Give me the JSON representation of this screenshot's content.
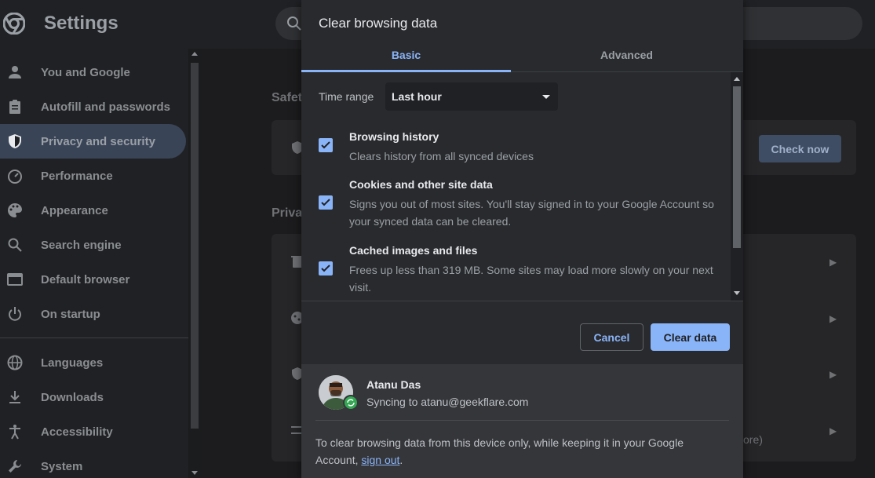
{
  "header": {
    "title": "Settings"
  },
  "sidebar": {
    "items": [
      {
        "label": "You and Google",
        "icon": "person-icon"
      },
      {
        "label": "Autofill and passwords",
        "icon": "clipboard-icon"
      },
      {
        "label": "Privacy and security",
        "icon": "shield-icon",
        "active": true
      },
      {
        "label": "Performance",
        "icon": "speedometer-icon"
      },
      {
        "label": "Appearance",
        "icon": "palette-icon"
      },
      {
        "label": "Search engine",
        "icon": "search-icon"
      },
      {
        "label": "Default browser",
        "icon": "browser-icon"
      },
      {
        "label": "On startup",
        "icon": "power-icon"
      },
      {
        "label": "Languages",
        "icon": "globe-icon"
      },
      {
        "label": "Downloads",
        "icon": "download-icon"
      },
      {
        "label": "Accessibility",
        "icon": "accessibility-icon"
      },
      {
        "label": "System",
        "icon": "wrench-icon"
      }
    ]
  },
  "main": {
    "section_safety": "Safet",
    "check_now": "Check now",
    "section_privacy": "Priva",
    "partial_text": "ore)"
  },
  "dialog": {
    "title": "Clear browsing data",
    "tabs": [
      "Basic",
      "Advanced"
    ],
    "time_range_label": "Time range",
    "time_range_value": "Last hour",
    "options": [
      {
        "title": "Browsing history",
        "desc": "Clears history from all synced devices",
        "checked": true
      },
      {
        "title": "Cookies and other site data",
        "desc": "Signs you out of most sites. You'll stay signed in to your Google Account so your synced data can be cleared.",
        "checked": true
      },
      {
        "title": "Cached images and files",
        "desc": "Frees up less than 319 MB. Some sites may load more slowly on your next visit.",
        "checked": true
      }
    ],
    "cancel": "Cancel",
    "clear": "Clear data",
    "user": {
      "name": "Atanu Das",
      "sync": "Syncing to atanu@geekflare.com"
    },
    "note_prefix": "To clear browsing data from this device only, while keeping it in your Google Account, ",
    "note_link": "sign out",
    "note_suffix": "."
  },
  "colors": {
    "accent": "#8ab4f8",
    "background": "#202124",
    "active_nav": "#394457",
    "sync_green": "#34a853"
  }
}
